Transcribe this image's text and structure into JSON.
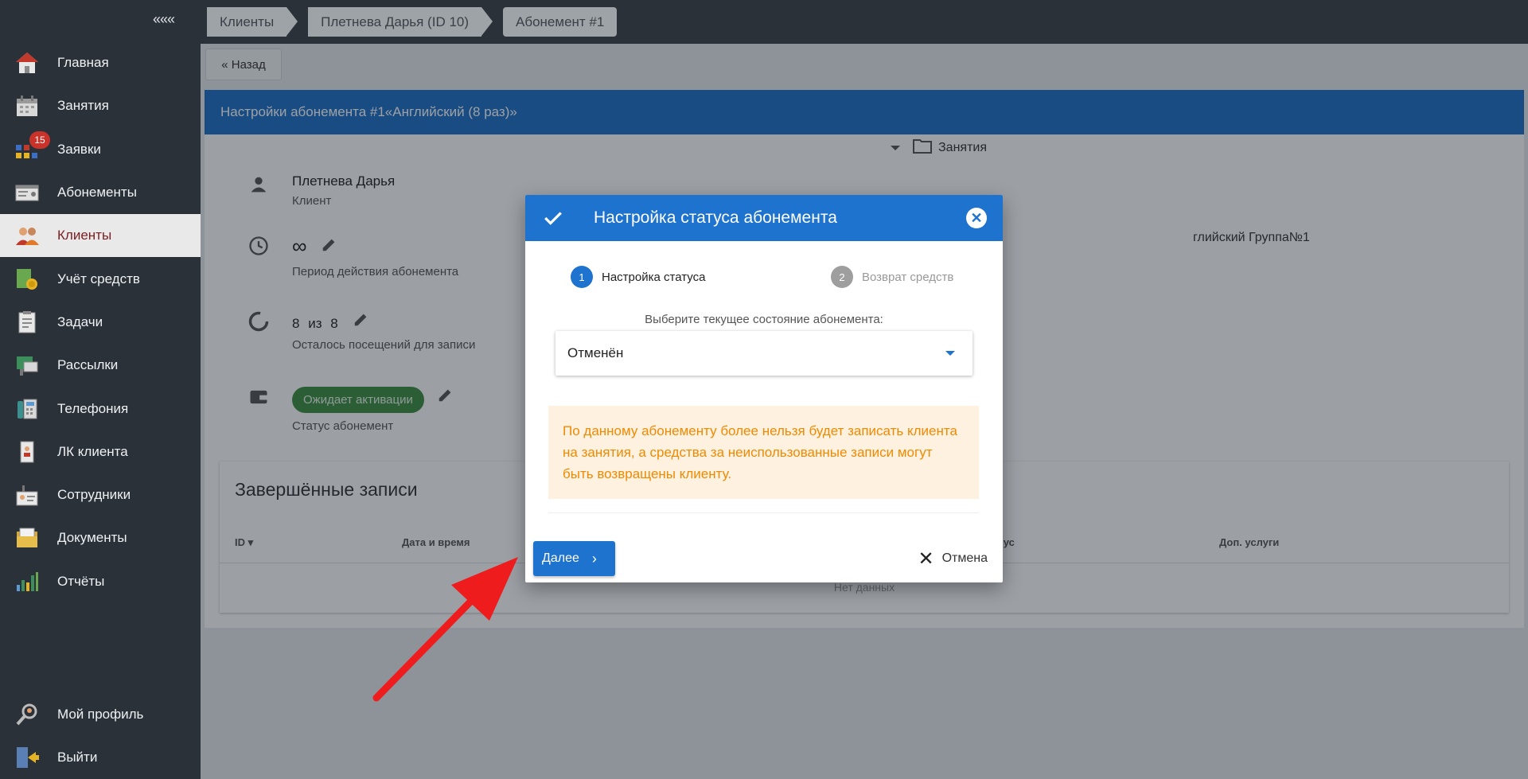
{
  "sidebar": {
    "collapse": "«««",
    "items": [
      {
        "label": "Главная",
        "icon": "home-icon"
      },
      {
        "label": "Занятия",
        "icon": "calendar-icon"
      },
      {
        "label": "Заявки",
        "icon": "requests-icon",
        "badge": "15"
      },
      {
        "label": "Абонементы",
        "icon": "subscription-card-icon"
      },
      {
        "label": "Клиенты",
        "icon": "clients-icon",
        "active": true
      },
      {
        "label": "Учёт средств",
        "icon": "finance-icon"
      },
      {
        "label": "Задачи",
        "icon": "tasks-icon"
      },
      {
        "label": "Рассылки",
        "icon": "mailing-icon"
      },
      {
        "label": "Телефония",
        "icon": "phone-icon"
      },
      {
        "label": "ЛК клиента",
        "icon": "client-cabinet-icon"
      },
      {
        "label": "Сотрудники",
        "icon": "staff-icon"
      },
      {
        "label": "Документы",
        "icon": "documents-icon"
      },
      {
        "label": "Отчёты",
        "icon": "reports-icon"
      }
    ],
    "bottom": [
      {
        "label": "Мой профиль",
        "icon": "profile-icon"
      },
      {
        "label": "Выйти",
        "icon": "logout-icon"
      }
    ]
  },
  "breadcrumbs": [
    "Клиенты",
    "Плетнева Дарья (ID 10)",
    "Абонемент #1"
  ],
  "back_label": "« Назад",
  "panel": {
    "title_prefix": "Настройки абонемента #1 ",
    "title_name": "«Английский (8 раз)»",
    "client_name": "Плетнева Дарья",
    "client_role": "Клиент",
    "period_value": "∞",
    "period_label": "Период действия абонемента",
    "visits_left": "8",
    "visits_of": "из",
    "visits_total": "8",
    "visits_label": "Осталось посещений для записи",
    "status_value": "Ожидает активации",
    "status_label": "Статус абонемент",
    "right_lessons": "Занятия",
    "right_group": "глийский Группа№1"
  },
  "records": {
    "title": "Завершённые записи",
    "columns": [
      "ID",
      "Дата и время",
      "тус",
      "Доп. услуги"
    ],
    "empty": "Нет данных"
  },
  "modal": {
    "title": "Настройка статуса абонемента",
    "steps": [
      {
        "num": "1",
        "label": "Настройка статуса"
      },
      {
        "num": "2",
        "label": "Возврат средств"
      }
    ],
    "select_label": "Выберите текущее состояние абонемента:",
    "select_value": "Отменён",
    "warning": "По данному абонементу более нельзя будет записать клиента на занятия, а средства за неиспользованные записи могут быть возвращены клиенту.",
    "next_label": "Далее",
    "cancel_label": "Отмена"
  },
  "colors": {
    "primary": "#1e73cf",
    "sidebar_bg": "#2b3138",
    "warning_text": "#ef8a00",
    "warning_bg": "#fff1e0",
    "status_chip": "#3e8e41",
    "annotation_arrow": "#ee1c1c"
  }
}
